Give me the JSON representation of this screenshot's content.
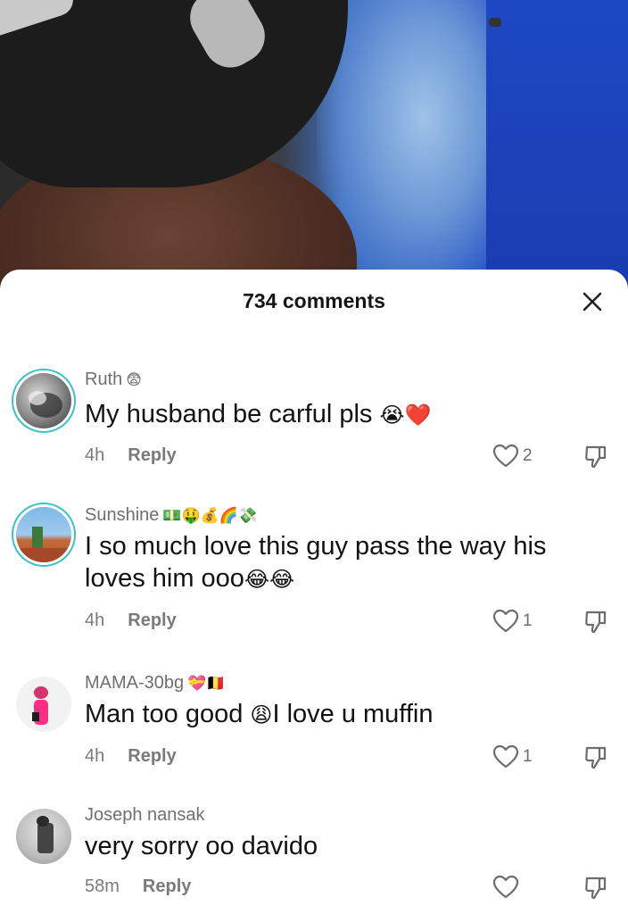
{
  "sheet": {
    "title": "734 comments"
  },
  "comments": [
    {
      "username": "Ruth",
      "username_emoji": "😨",
      "text": "My husband be carful pls",
      "text_emoji": "😭❤️",
      "time": "4h",
      "reply": "Reply",
      "likes": "2"
    },
    {
      "username": "Sunshine",
      "username_emoji": "💵🤑💰🌈💸",
      "text": "I so much love this guy pass the way his loves him ooo",
      "text_emoji": "😂😂",
      "time": "4h",
      "reply": "Reply",
      "likes": "1"
    },
    {
      "username": "MAMA-30bg",
      "username_emoji": "💝🇧🇪",
      "text_before": "Man too good ",
      "text_emoji": "😩",
      "text_after": "I love u muffin",
      "time": "4h",
      "reply": "Reply",
      "likes": "1"
    },
    {
      "username": "Joseph nansak",
      "text": "very sorry oo davido",
      "time": "58m",
      "reply": "Reply",
      "likes": ""
    }
  ],
  "colors": {
    "story_ring": "#37c3c8",
    "heart_red": "#e8212e"
  },
  "icons": [
    "close-icon",
    "heart-outline-icon",
    "dislike-icon"
  ]
}
